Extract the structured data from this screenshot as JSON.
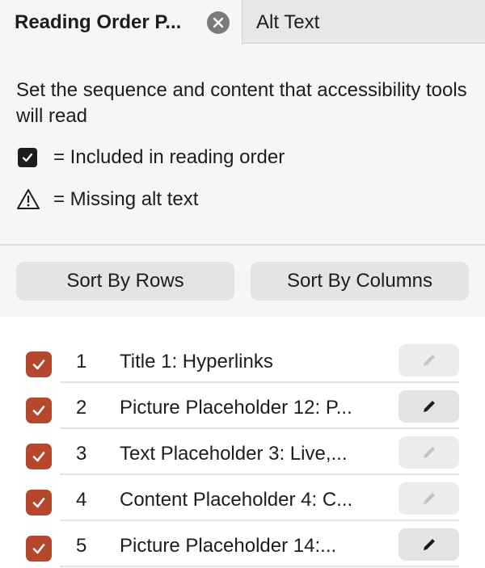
{
  "tabs": [
    {
      "label": "Reading Order P...",
      "active": true
    },
    {
      "label": "Alt Text",
      "active": false
    }
  ],
  "intro": "Set the sequence and content that accessibility tools will read",
  "legend": {
    "included": "= Included in reading order",
    "missing": "= Missing alt text"
  },
  "sort": {
    "rows_label": "Sort By Rows",
    "columns_label": "Sort By Columns"
  },
  "items": [
    {
      "index": "1",
      "name": "Title 1: Hyperlinks",
      "checked": true,
      "edit_enabled": false
    },
    {
      "index": "2",
      "name": "Picture Placeholder 12: P...",
      "checked": true,
      "edit_enabled": true
    },
    {
      "index": "3",
      "name": "Text Placeholder 3: Live,...",
      "checked": true,
      "edit_enabled": false
    },
    {
      "index": "4",
      "name": "Content Placeholder 4: C...",
      "checked": true,
      "edit_enabled": false
    },
    {
      "index": "5",
      "name": "Picture Placeholder 14:...",
      "checked": true,
      "edit_enabled": true
    }
  ],
  "colors": {
    "checkbox": "#b5472c",
    "panel_bg": "#f6f6f6",
    "list_bg": "#ffffff"
  },
  "icons": {
    "tab_close": "close-icon",
    "legend_check": "checkbox-checked-icon",
    "legend_warning": "warning-icon",
    "row_check": "checkbox-checked-icon",
    "row_edit": "pencil-icon"
  }
}
